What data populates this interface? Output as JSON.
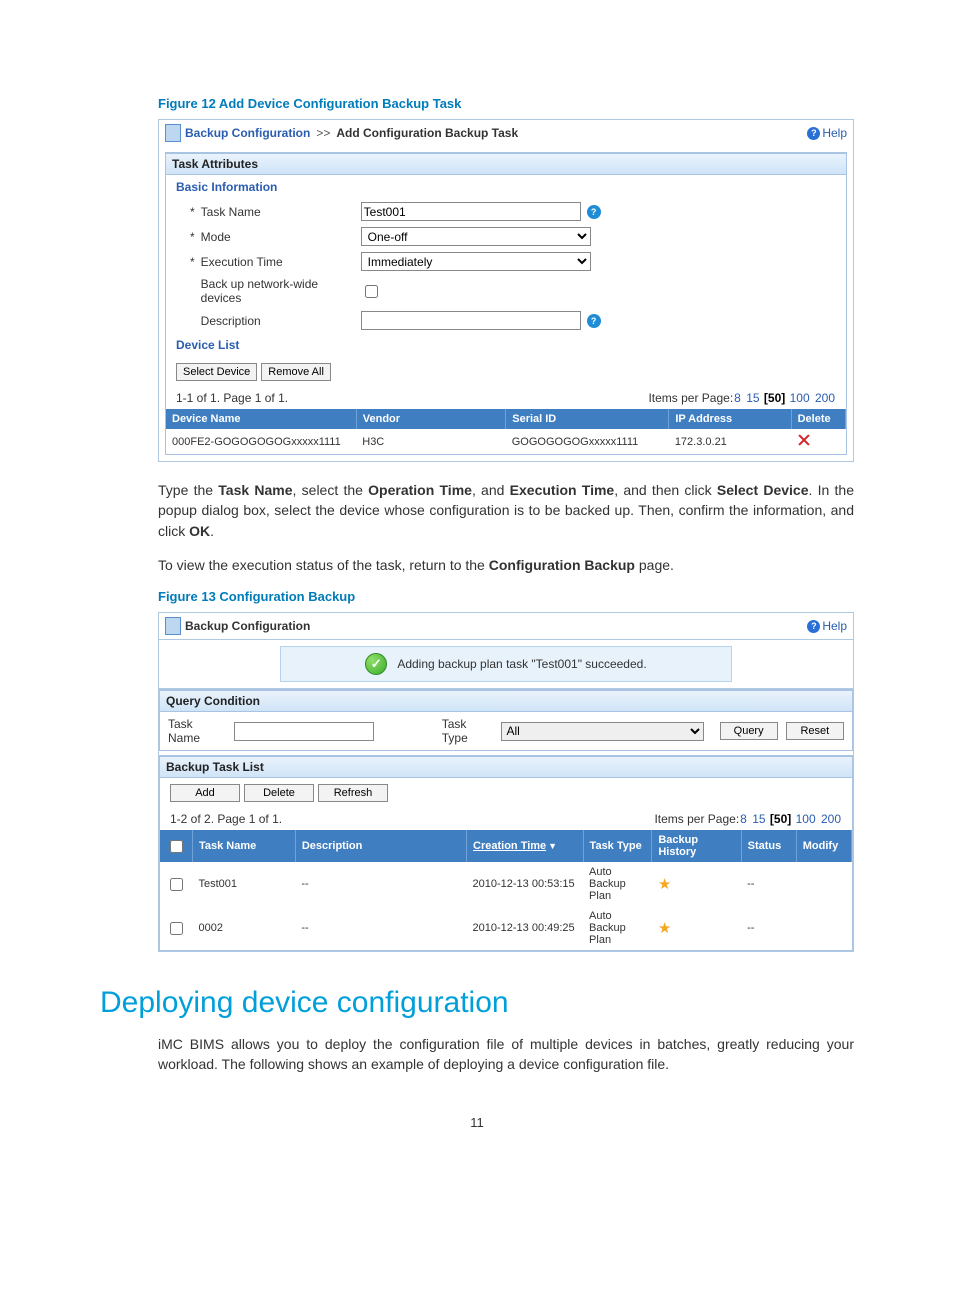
{
  "figure12": {
    "caption": "Figure 12 Add Device Configuration Backup Task",
    "breadcrumb_link": "Backup Configuration",
    "breadcrumb_sep": ">>",
    "breadcrumb_current": "Add Configuration Backup Task",
    "help": "Help",
    "task_attr_header": "Task Attributes",
    "basic_info_header": "Basic Information",
    "labels": {
      "task_name": "Task Name",
      "mode": "Mode",
      "exec_time": "Execution Time",
      "backup_nw": "Back up network-wide devices",
      "description": "Description"
    },
    "values": {
      "task_name": "Test001",
      "mode": "One-off",
      "exec_time": "Immediately",
      "description": ""
    },
    "device_list_header": "Device List",
    "buttons": {
      "select_device": "Select Device",
      "remove_all": "Remove All"
    },
    "pager_left": "1-1 of 1. Page 1 of 1.",
    "pager_label": "Items per Page:",
    "pager_opts": [
      "8",
      "15",
      "[50]",
      "100",
      "200"
    ],
    "table_headers": [
      "Device Name",
      "Vendor",
      "Serial ID",
      "IP Address",
      "Delete"
    ],
    "row": {
      "device_name": "000FE2-GOGOGOGOGxxxxx1111",
      "vendor": "H3C",
      "serial": "GOGOGOGOGxxxxx1111",
      "ip": "172.3.0.21"
    }
  },
  "para1_pre": "Type the ",
  "para1_b1": "Task Name",
  "para1_m1": ", select the ",
  "para1_b2": "Operation Time",
  "para1_m2": ", and ",
  "para1_b3": "Execution Time",
  "para1_m3": ", and then click ",
  "para1_b4": "Select Device",
  "para1_m4": ". In the popup dialog box, select the device whose configuration is to be backed up. Then, confirm the information, and click ",
  "para1_b5": "OK",
  "para1_end": ".",
  "para2_pre": "To view the execution status of the task, return to the ",
  "para2_b1": "Configuration Backup",
  "para2_end": " page.",
  "figure13": {
    "caption": "Figure 13 Configuration Backup",
    "breadcrumb_link": "Backup Configuration",
    "help": "Help",
    "success_msg": "Adding backup plan task \"Test001\" succeeded.",
    "query_header": "Query Condition",
    "labels": {
      "task_name": "Task Name",
      "task_type": "Task Type"
    },
    "task_type_value": "All",
    "buttons": {
      "query": "Query",
      "reset": "Reset",
      "add": "Add",
      "delete": "Delete",
      "refresh": "Refresh"
    },
    "list_header": "Backup Task List",
    "pager_left": "1-2 of 2. Page 1 of 1.",
    "pager_label": "Items per Page:",
    "pager_opts": [
      "8",
      "15",
      "[50]",
      "100",
      "200"
    ],
    "table_headers": [
      "",
      "Task Name",
      "Description",
      "Creation Time",
      "Task Type",
      "Backup History",
      "Status",
      "Modify"
    ],
    "rows": [
      {
        "name": "Test001",
        "desc": "--",
        "ctime": "2010-12-13 00:53:15",
        "type": "Auto Backup Plan",
        "status": "--"
      },
      {
        "name": "0002",
        "desc": "--",
        "ctime": "2010-12-13 00:49:25",
        "type": "Auto Backup Plan",
        "status": "--"
      }
    ]
  },
  "heading": "Deploying device configuration",
  "para3": "iMC BIMS allows you to deploy the configuration file of multiple devices in batches, greatly reducing your workload. The following shows an example of deploying a device configuration file.",
  "page_number": "11"
}
